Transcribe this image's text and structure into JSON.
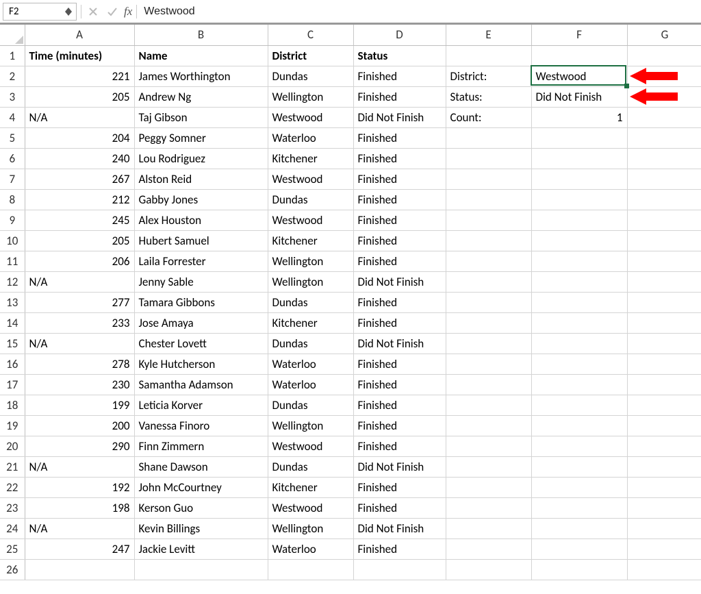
{
  "formula_bar": {
    "cell_ref": "F2",
    "value": "Westwood"
  },
  "columns": [
    "A",
    "B",
    "C",
    "D",
    "E",
    "F",
    "G"
  ],
  "headers": {
    "A": "Time (minutes)",
    "B": "Name",
    "C": "District",
    "D": "Status"
  },
  "side": {
    "E2": "District:",
    "F2": "Westwood",
    "E3": "Status:",
    "F3": "Did Not Finish",
    "E4": "Count:",
    "F4": "1"
  },
  "rows": [
    {
      "n": 2,
      "time": "221",
      "name": "James Worthington",
      "district": "Dundas",
      "status": "Finished"
    },
    {
      "n": 3,
      "time": "205",
      "name": "Andrew Ng",
      "district": "Wellington",
      "status": "Finished"
    },
    {
      "n": 4,
      "time": "N/A",
      "name": "Taj Gibson",
      "district": "Westwood",
      "status": "Did Not Finish"
    },
    {
      "n": 5,
      "time": "204",
      "name": "Peggy Somner",
      "district": "Waterloo",
      "status": "Finished"
    },
    {
      "n": 6,
      "time": "240",
      "name": "Lou Rodriguez",
      "district": "Kitchener",
      "status": "Finished"
    },
    {
      "n": 7,
      "time": "267",
      "name": "Alston Reid",
      "district": "Westwood",
      "status": "Finished"
    },
    {
      "n": 8,
      "time": "212",
      "name": "Gabby Jones",
      "district": "Dundas",
      "status": "Finished"
    },
    {
      "n": 9,
      "time": "245",
      "name": "Alex Houston",
      "district": "Westwood",
      "status": "Finished"
    },
    {
      "n": 10,
      "time": "205",
      "name": "Hubert Samuel",
      "district": "Kitchener",
      "status": "Finished"
    },
    {
      "n": 11,
      "time": "206",
      "name": "Laila Forrester",
      "district": "Wellington",
      "status": "Finished"
    },
    {
      "n": 12,
      "time": "N/A",
      "name": "Jenny Sable",
      "district": "Wellington",
      "status": "Did Not Finish"
    },
    {
      "n": 13,
      "time": "277",
      "name": "Tamara Gibbons",
      "district": "Dundas",
      "status": "Finished"
    },
    {
      "n": 14,
      "time": "233",
      "name": "Jose Amaya",
      "district": "Kitchener",
      "status": "Finished"
    },
    {
      "n": 15,
      "time": "N/A",
      "name": "Chester Lovett",
      "district": "Dundas",
      "status": "Did Not Finish"
    },
    {
      "n": 16,
      "time": "278",
      "name": "Kyle Hutcherson",
      "district": "Waterloo",
      "status": "Finished"
    },
    {
      "n": 17,
      "time": "230",
      "name": "Samantha Adamson",
      "district": "Waterloo",
      "status": "Finished"
    },
    {
      "n": 18,
      "time": "199",
      "name": "Leticia Korver",
      "district": "Dundas",
      "status": "Finished"
    },
    {
      "n": 19,
      "time": "200",
      "name": "Vanessa Finoro",
      "district": "Wellington",
      "status": "Finished"
    },
    {
      "n": 20,
      "time": "290",
      "name": "Finn Zimmern",
      "district": "Westwood",
      "status": "Finished"
    },
    {
      "n": 21,
      "time": "N/A",
      "name": "Shane Dawson",
      "district": "Dundas",
      "status": "Did Not Finish"
    },
    {
      "n": 22,
      "time": "192",
      "name": "John McCourtney",
      "district": "Kitchener",
      "status": "Finished"
    },
    {
      "n": 23,
      "time": "198",
      "name": "Kerson Guo",
      "district": "Westwood",
      "status": "Finished"
    },
    {
      "n": 24,
      "time": "N/A",
      "name": "Kevin Billings",
      "district": "Wellington",
      "status": "Did Not Finish"
    },
    {
      "n": 25,
      "time": "247",
      "name": "Jackie Levitt",
      "district": "Waterloo",
      "status": "Finished"
    }
  ],
  "row_labels": [
    "1",
    "2",
    "3",
    "4",
    "5",
    "6",
    "7",
    "8",
    "9",
    "10",
    "11",
    "12",
    "13",
    "14",
    "15",
    "16",
    "17",
    "18",
    "19",
    "20",
    "21",
    "22",
    "23",
    "24",
    "25",
    "26"
  ]
}
